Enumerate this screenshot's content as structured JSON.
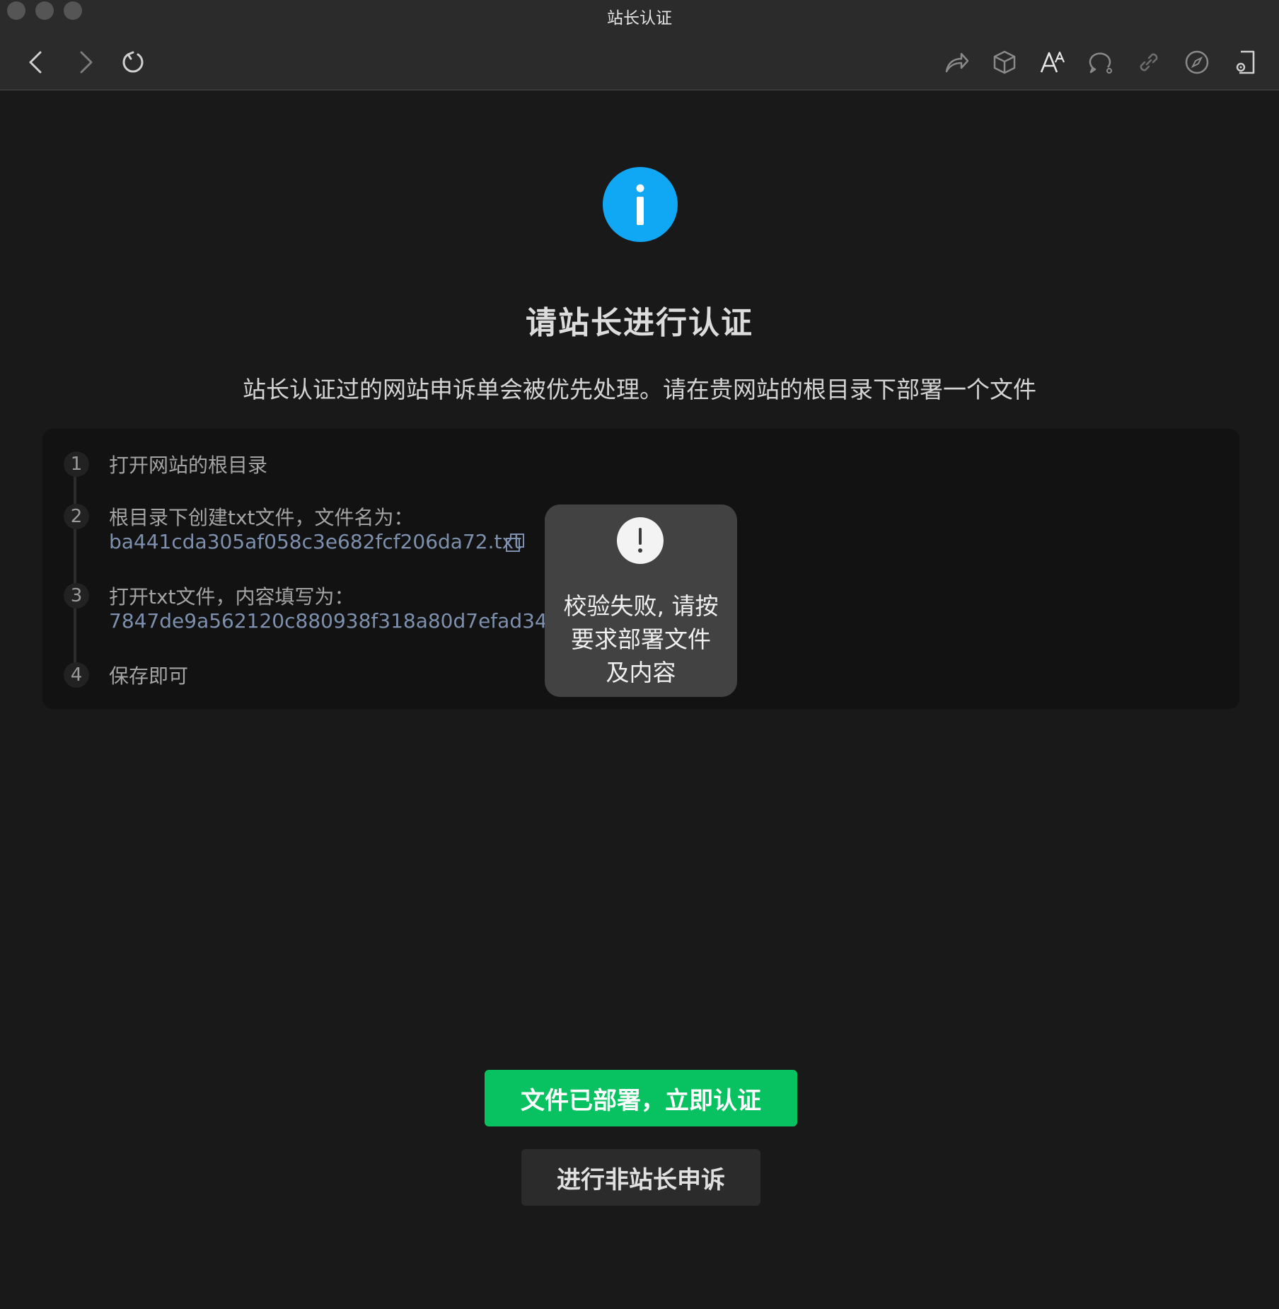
{
  "window": {
    "title": "站长认证"
  },
  "toolbar": {
    "nav": [
      "back-icon",
      "forward-icon",
      "refresh-icon"
    ],
    "tools": [
      "share-icon",
      "cube-icon",
      "font-size-icon",
      "chat-icon",
      "link-icon",
      "compass-icon",
      "device-icon"
    ]
  },
  "main": {
    "icon": "info-icon",
    "title": "请站长进行认证",
    "description": "站长认证过的网站申诉单会被优先处理。请在贵网站的根目录下部署一个文件",
    "steps": [
      {
        "num": "1",
        "text": "打开网站的根目录"
      },
      {
        "num": "2",
        "text": "根目录下创建txt文件，文件名为：",
        "value": "ba441cda305af058c3e682fcf206da72.txt"
      },
      {
        "num": "3",
        "text": "打开txt文件，内容填写为：",
        "value": "7847de9a562120c880938f318a80d7efad345a7"
      },
      {
        "num": "4",
        "text": "保存即可"
      }
    ]
  },
  "toast": {
    "icon": "exclamation-icon",
    "message": "校验失败, 请按要求部署文件及内容"
  },
  "buttons": {
    "primary": "文件已部署，立即认证",
    "secondary": "进行非站长申诉"
  },
  "colors": {
    "info": "#10a7f5",
    "primary": "#08c160",
    "link": "#7d90ad",
    "background": "#191919"
  }
}
